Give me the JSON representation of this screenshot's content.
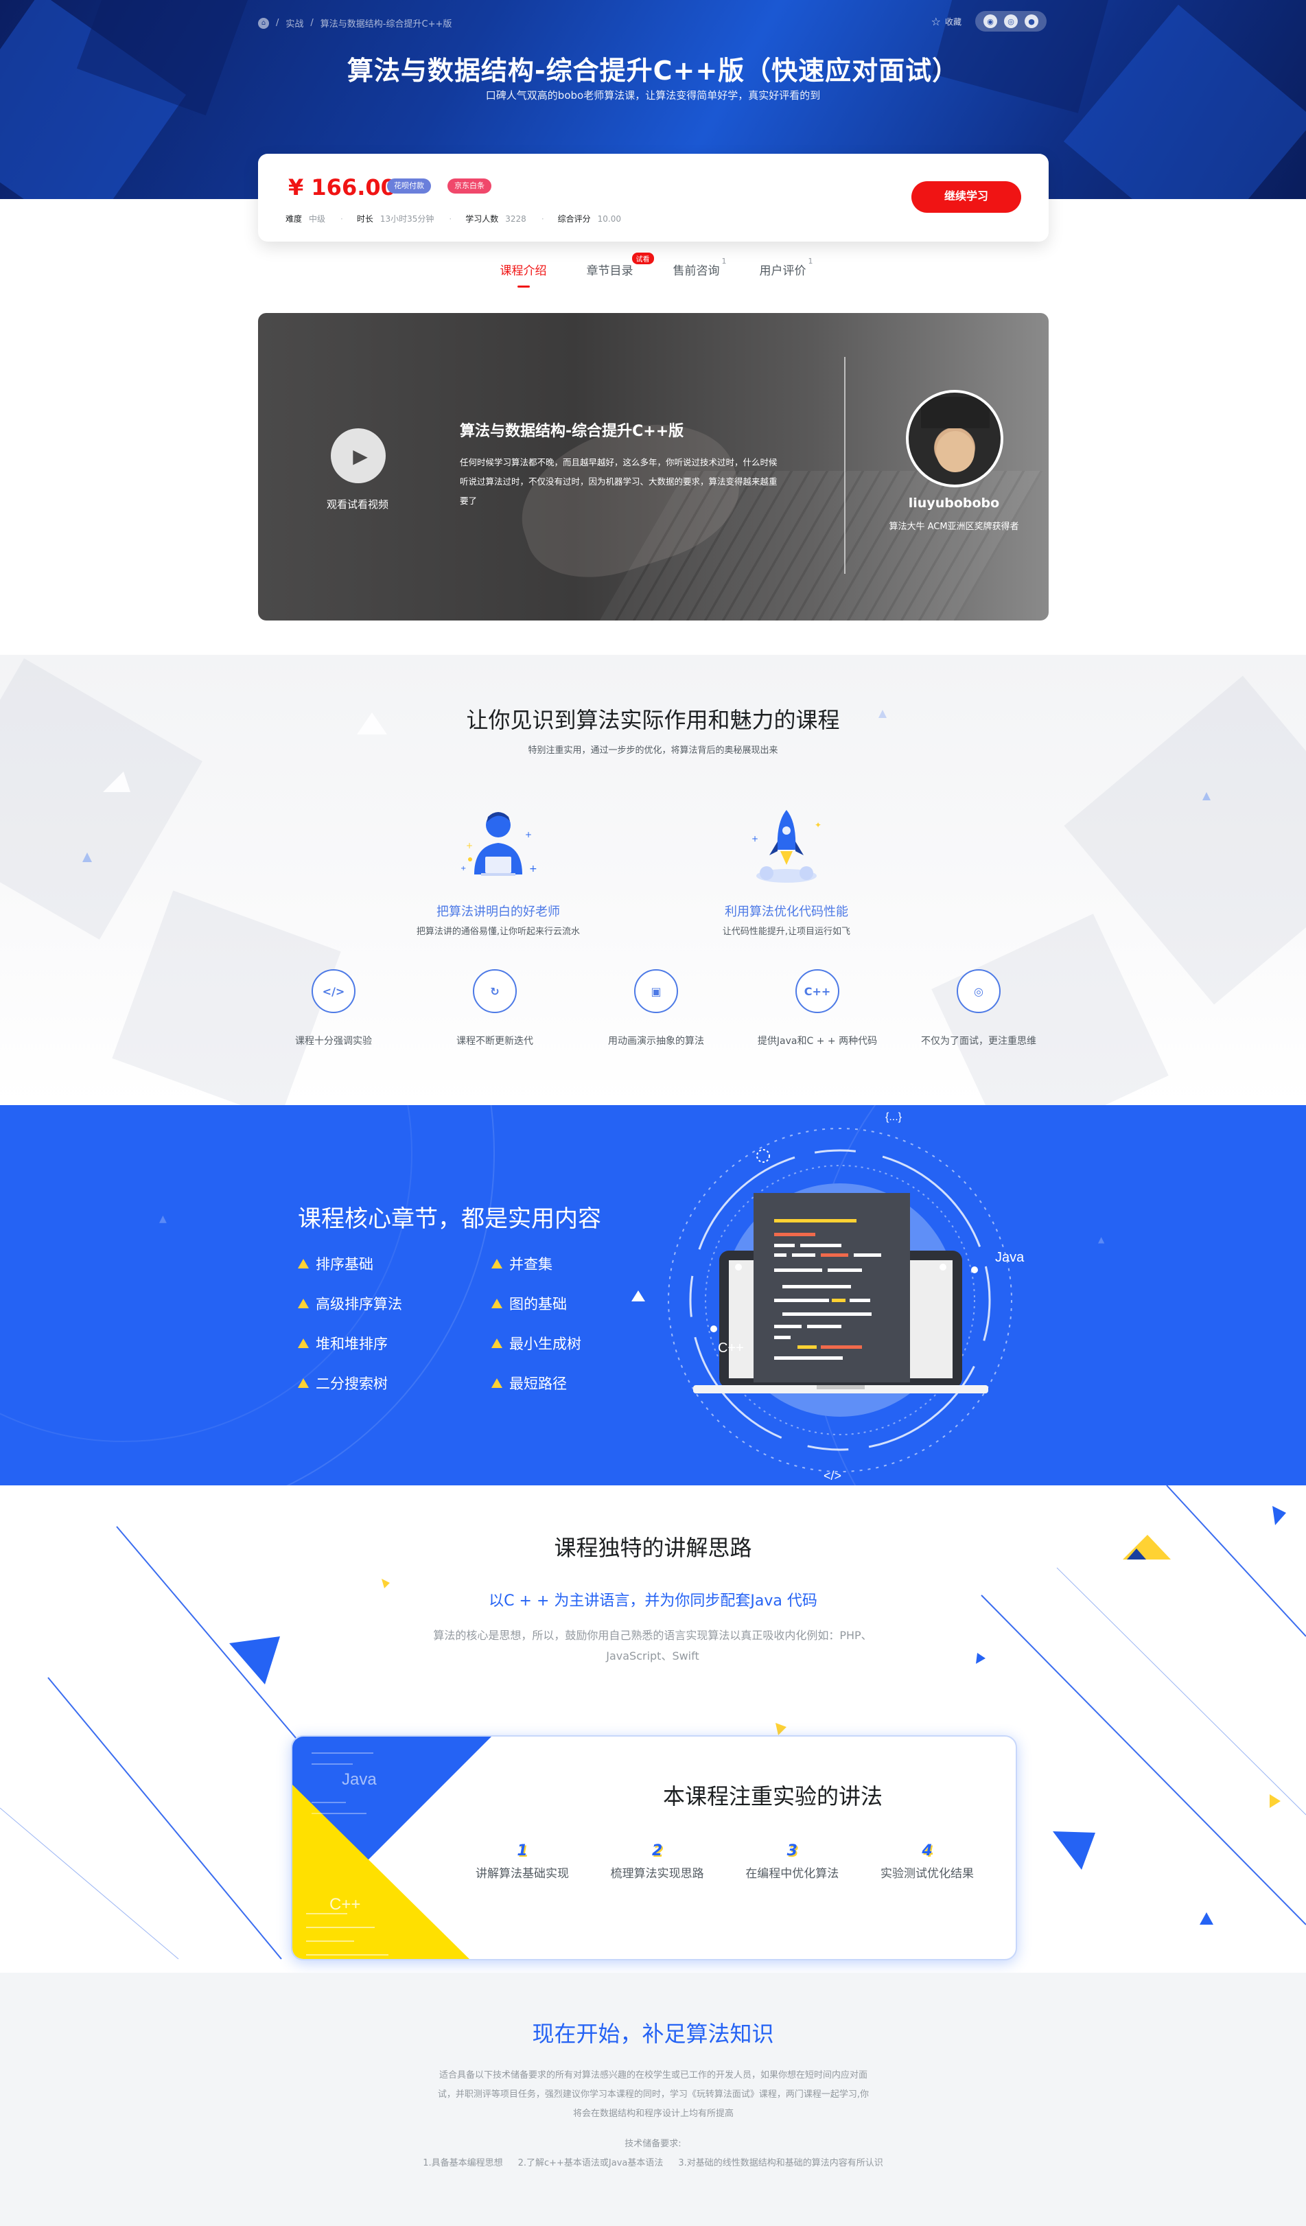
{
  "breadcrumb": {
    "items": [
      "实战",
      "算法与数据结构-综合提升C++版"
    ]
  },
  "hero": {
    "favorite_label": "收藏",
    "title": "算法与数据结构-综合提升C++版（快速应对面试）",
    "subtitle": "口碑人气双高的bobo老师算法课，让算法变得简单好学，真实好评看的到"
  },
  "price_card": {
    "price": "¥ 166.00",
    "tag1": "花呗付款",
    "tag2": "京东白条",
    "meta": [
      {
        "key": "难度",
        "value": "中级"
      },
      {
        "key": "时长",
        "value": "13小时35分钟"
      },
      {
        "key": "学习人数",
        "value": "3228"
      },
      {
        "key": "综合评分",
        "value": "10.00"
      }
    ],
    "study_button": "继续学习"
  },
  "tabs": [
    {
      "label": "课程介绍",
      "active": true
    },
    {
      "label": "章节目录",
      "badge": "试看"
    },
    {
      "label": "售前咨询",
      "sup": "1"
    },
    {
      "label": "用户评价",
      "sup": "1"
    }
  ],
  "video": {
    "play_label": "观看试看视频",
    "title": "算法与数据结构-综合提升C++版",
    "description": "任何时候学习算法都不晚，而且越早越好，这么多年，你听说过技术过时，什么时候听说过算法过时，不仅没有过时，因为机器学习、大数据的要求，算法变得越来越重要了",
    "teacher_name": "liuyubobobo",
    "teacher_title": "算法大牛 ACM亚洲区奖牌获得者"
  },
  "features": {
    "title": "让你见识到算法实际作用和魅力的课程",
    "subtitle": "特别注重实用，通过一步步的优化，将算法背后的奥秘展现出来",
    "big": [
      {
        "title": "把算法讲明白的好老师",
        "desc": "把算法讲的通俗易懂,让你听起来行云流水",
        "icon": "teacher-icon"
      },
      {
        "title": "利用算法优化代码性能",
        "desc": "让代码性能提升,让项目运行如飞",
        "icon": "rocket-icon"
      }
    ],
    "small": [
      {
        "label": "课程十分强调实验",
        "icon": "code-icon",
        "glyph": "</>"
      },
      {
        "label": "课程不断更新迭代",
        "icon": "refresh-icon",
        "glyph": "↻"
      },
      {
        "label": "用动画演示抽象的算法",
        "icon": "film-icon",
        "glyph": "▣"
      },
      {
        "label": "提供Java和C + + 两种代码",
        "icon": "cpp-icon",
        "glyph": "C++"
      },
      {
        "label": "不仅为了面试，更注重思维",
        "icon": "lightbulb-icon",
        "glyph": "◎"
      }
    ]
  },
  "core": {
    "title": "课程核心章节，都是实用内容",
    "items": [
      "排序基础",
      "并查集",
      "高级排序算法",
      "图的基础",
      "堆和堆排序",
      "最小生成树",
      "二分搜索树",
      "最短路径"
    ],
    "art_labels": {
      "java": "Java",
      "cpp": "C++",
      "code": "</>",
      "braces": "{...}"
    }
  },
  "method": {
    "title": "课程独特的讲解思路",
    "subtitle": "以C + + 为主讲语言，并为你同步配套Java 代码",
    "desc": "算法的核心是思想，所以，鼓励你用自己熟悉的语言实现算法以真正吸收内化例如：PHP、JavaScript、Swift",
    "card_title": "本课程注重实验的讲法",
    "card_labels": {
      "java": "Java",
      "cpp": "C++"
    },
    "steps": [
      {
        "num": "1",
        "label": "讲解算法基础实现"
      },
      {
        "num": "2",
        "label": "梳理算法实现思路"
      },
      {
        "num": "3",
        "label": "在编程中优化算法"
      },
      {
        "num": "4",
        "label": "实验测试优化结果"
      }
    ]
  },
  "start": {
    "title": "现在开始，补足算法知识",
    "desc": "适合具备以下技术储备要求的所有对算法感兴趣的在校学生或已工作的开发人员，如果你想在短时间内应对面试，并职测评等项目任务，强烈建议你学习本课程的同时，学习《玩转算法面试》课程，两门课程一起学习,你将会在数据结构和程序设计上均有所提高",
    "req_title": "技术储备要求:",
    "reqs": [
      "1.具备基本编程思想",
      "2.了解c++基本语法或Java基本语法",
      "3.对基础的线性数据结构和基础的算法内容有所认识"
    ]
  },
  "colors": {
    "accent_red": "#f01414",
    "brand_blue": "#2563f4",
    "highlight_yellow": "#ffd233"
  }
}
